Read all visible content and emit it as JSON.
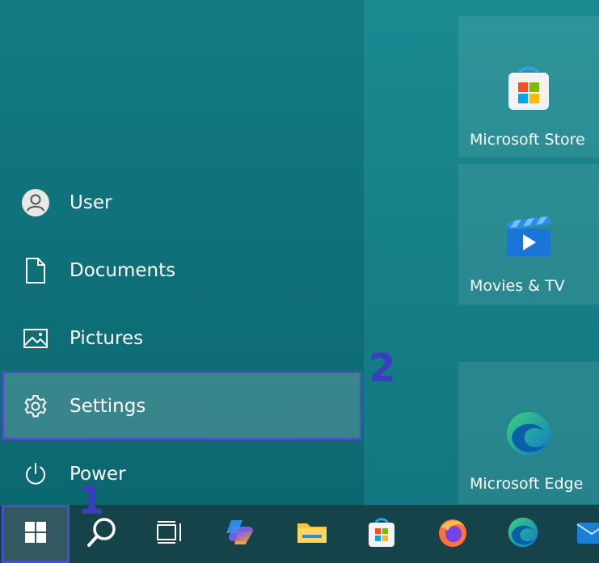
{
  "start_menu": {
    "items": [
      {
        "label": "User",
        "icon": "user-avatar-icon"
      },
      {
        "label": "Documents",
        "icon": "document-icon"
      },
      {
        "label": "Pictures",
        "icon": "pictures-icon"
      },
      {
        "label": "Settings",
        "icon": "gear-icon",
        "highlighted": true
      },
      {
        "label": "Power",
        "icon": "power-icon"
      }
    ]
  },
  "tiles": [
    {
      "label": "Microsoft Store",
      "icon": "microsoft-store-icon"
    },
    {
      "label": "Movies & TV",
      "icon": "movies-tv-icon"
    },
    {
      "label": "Microsoft Edge",
      "icon": "edge-icon"
    }
  ],
  "callouts": {
    "step1": "1",
    "step2": "2"
  },
  "taskbar": {
    "items": [
      "start-icon",
      "search-icon",
      "task-view-icon",
      "copilot-icon",
      "file-explorer-icon",
      "microsoft-store-icon",
      "firefox-icon",
      "edge-icon",
      "mail-icon"
    ]
  },
  "colors": {
    "highlight_border": "#4a4fc4",
    "callout_text": "#3c3cc0",
    "menu_bg": "#0f7079",
    "taskbar_bg": "#16434a"
  }
}
